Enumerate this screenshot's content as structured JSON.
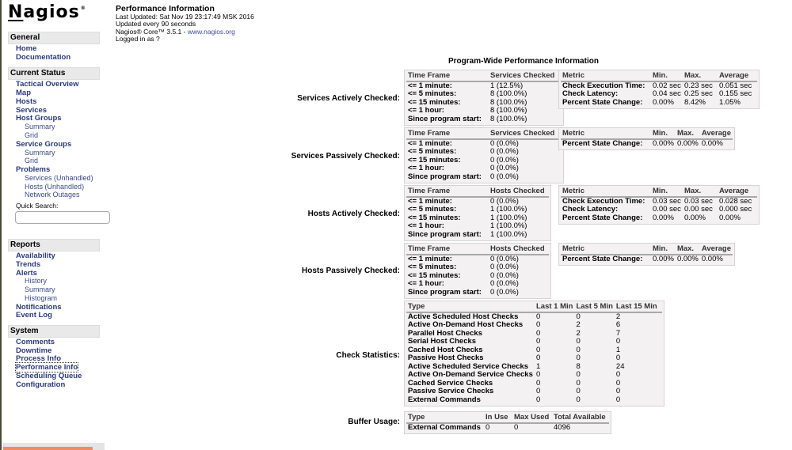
{
  "sidebar": {
    "logo": "Nagios",
    "logo_mark": "®",
    "sections": {
      "general": {
        "title": "General",
        "items": [
          "Home",
          "Documentation"
        ]
      },
      "current_status": {
        "title": "Current Status",
        "items": {
          "tactical_overview": "Tactical Overview",
          "map": "Map",
          "hosts": "Hosts",
          "services": "Services",
          "host_groups": "Host Groups",
          "host_groups_summary": "Summary",
          "host_groups_grid": "Grid",
          "service_groups": "Service Groups",
          "service_groups_summary": "Summary",
          "service_groups_grid": "Grid",
          "problems": "Problems",
          "services_prob": "Services",
          "services_unhandled": "(Unhandled)",
          "hosts_prob": "Hosts",
          "hosts_unhandled": "(Unhandled)",
          "network_outages": "Network Outages"
        },
        "quick_search_label": "Quick Search:",
        "quick_search_value": ""
      },
      "reports": {
        "title": "Reports",
        "items": {
          "availability": "Availability",
          "trends": "Trends",
          "alerts": "Alerts",
          "history": "History",
          "summary": "Summary",
          "histogram": "Histogram",
          "notifications": "Notifications",
          "event_log": "Event Log"
        }
      },
      "system": {
        "title": "System",
        "items": [
          "Comments",
          "Downtime",
          "Process Info",
          "Performance Info",
          "Scheduling Queue",
          "Configuration"
        ],
        "selected": "Performance Info"
      }
    }
  },
  "header": {
    "title": "Performance Information",
    "last_updated": "Last Updated: Sat Nov 19 23:17:49 MSK 2016",
    "update_interval": "Updated every 90 seconds",
    "version_prefix": "Nagios® Core™ 3.5.1 - ",
    "version_link": "www.nagios.org",
    "logged_in": "Logged in as ?"
  },
  "main": {
    "title": "Program-Wide Performance Information",
    "services_active": {
      "label": "Services Actively Checked:",
      "timeframe": {
        "headers": [
          "Time Frame",
          "Services Checked"
        ],
        "rows": [
          [
            "<= 1 minute:",
            "1 (12.5%)"
          ],
          [
            "<= 5 minutes:",
            "8 (100.0%)"
          ],
          [
            "<= 15 minutes:",
            "8 (100.0%)"
          ],
          [
            "<= 1 hour:",
            "8 (100.0%)"
          ],
          [
            "Since program start:",
            "8 (100.0%)"
          ]
        ]
      },
      "metrics": {
        "headers": [
          "Metric",
          "Min.",
          "Max.",
          "Average"
        ],
        "rows": [
          [
            "Check Execution Time:",
            "0.02 sec",
            "0.23 sec",
            "0.051 sec"
          ],
          [
            "Check Latency:",
            "0.04 sec",
            "0.25 sec",
            "0.155 sec"
          ],
          [
            "Percent State Change:",
            "0.00%",
            "8.42%",
            "1.05%"
          ]
        ]
      }
    },
    "services_passive": {
      "label": "Services Passively Checked:",
      "timeframe": {
        "headers": [
          "Time Frame",
          "Services Checked"
        ],
        "rows": [
          [
            "<= 1 minute:",
            "0 (0.0%)"
          ],
          [
            "<= 5 minutes:",
            "0 (0.0%)"
          ],
          [
            "<= 15 minutes:",
            "0 (0.0%)"
          ],
          [
            "<= 1 hour:",
            "0 (0.0%)"
          ],
          [
            "Since program start:",
            "0 (0.0%)"
          ]
        ]
      },
      "metrics": {
        "headers": [
          "Metric",
          "Min.",
          "Max.",
          "Average"
        ],
        "rows": [
          [
            "Percent State Change:",
            "0.00%",
            "0.00%",
            "0.00%"
          ]
        ]
      }
    },
    "hosts_active": {
      "label": "Hosts Actively Checked:",
      "timeframe": {
        "headers": [
          "Time Frame",
          "Hosts Checked"
        ],
        "rows": [
          [
            "<= 1 minute:",
            "0 (0.0%)"
          ],
          [
            "<= 5 minutes:",
            "1 (100.0%)"
          ],
          [
            "<= 15 minutes:",
            "1 (100.0%)"
          ],
          [
            "<= 1 hour:",
            "1 (100.0%)"
          ],
          [
            "Since program start:",
            "1 (100.0%)"
          ]
        ]
      },
      "metrics": {
        "headers": [
          "Metric",
          "Min.",
          "Max.",
          "Average"
        ],
        "rows": [
          [
            "Check Execution Time:",
            "0.03 sec",
            "0.03 sec",
            "0.028 sec"
          ],
          [
            "Check Latency:",
            "0.00 sec",
            "0.00 sec",
            "0.000 sec"
          ],
          [
            "Percent State Change:",
            "0.00%",
            "0.00%",
            "0.00%"
          ]
        ]
      }
    },
    "hosts_passive": {
      "label": "Hosts Passively Checked:",
      "timeframe": {
        "headers": [
          "Time Frame",
          "Hosts Checked"
        ],
        "rows": [
          [
            "<= 1 minute:",
            "0 (0.0%)"
          ],
          [
            "<= 5 minutes:",
            "0 (0.0%)"
          ],
          [
            "<= 15 minutes:",
            "0 (0.0%)"
          ],
          [
            "<= 1 hour:",
            "0 (0.0%)"
          ],
          [
            "Since program start:",
            "0 (0.0%)"
          ]
        ]
      },
      "metrics": {
        "headers": [
          "Metric",
          "Min.",
          "Max.",
          "Average"
        ],
        "rows": [
          [
            "Percent State Change:",
            "0.00%",
            "0.00%",
            "0.00%"
          ]
        ]
      }
    },
    "check_statistics": {
      "label": "Check Statistics:",
      "headers": [
        "Type",
        "Last 1 Min",
        "Last 5 Min",
        "Last 15 Min"
      ],
      "rows": [
        [
          "Active Scheduled Host Checks",
          "0",
          "0",
          "2"
        ],
        [
          "Active On-Demand Host Checks",
          "0",
          "2",
          "6"
        ],
        [
          "Parallel Host Checks",
          "0",
          "2",
          "7"
        ],
        [
          "Serial Host Checks",
          "0",
          "0",
          "0"
        ],
        [
          "Cached Host Checks",
          "0",
          "0",
          "1"
        ],
        [
          "Passive Host Checks",
          "0",
          "0",
          "0"
        ],
        [
          "Active Scheduled Service Checks",
          "1",
          "8",
          "24"
        ],
        [
          "Active On-Demand Service Checks",
          "0",
          "0",
          "0"
        ],
        [
          "Cached Service Checks",
          "0",
          "0",
          "0"
        ],
        [
          "Passive Service Checks",
          "0",
          "0",
          "0"
        ],
        [
          "External Commands",
          "0",
          "0",
          "0"
        ]
      ]
    },
    "buffer_usage": {
      "label": "Buffer Usage:",
      "headers": [
        "Type",
        "In Use",
        "Max Used",
        "Total Available"
      ],
      "rows": [
        [
          "External Commands",
          "0",
          "0",
          "4096"
        ]
      ]
    }
  }
}
